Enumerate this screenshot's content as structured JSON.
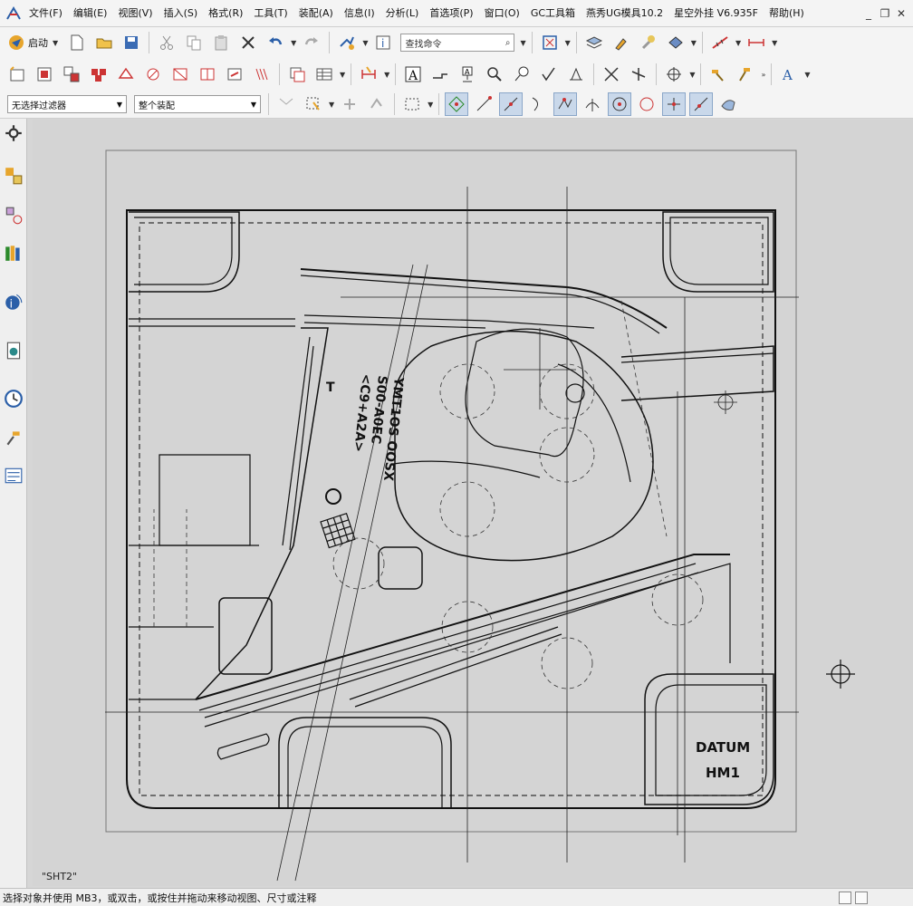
{
  "menu": {
    "items": [
      "文件(F)",
      "编辑(E)",
      "视图(V)",
      "插入(S)",
      "格式(R)",
      "工具(T)",
      "装配(A)",
      "信息(I)",
      "分析(L)",
      "首选项(P)",
      "窗口(O)",
      "GC工具箱",
      "燕秀UG模具10.2",
      "星空外挂 V6.935F",
      "帮助(H)"
    ]
  },
  "toolbar": {
    "start_label": "启动",
    "command_search_placeholder": "查找命令"
  },
  "selection": {
    "filter_value": "无选择过滤器",
    "scope_value": "整个装配"
  },
  "drawing": {
    "sheet_name": "\"SHT2\"",
    "engrave_line1": "YMT1OS OOSX",
    "engrave_line2": "S00-A0EC",
    "engrave_line3": "<C9+A2A>",
    "datum_label_line1": "DATUM",
    "datum_label_line2": "HM1",
    "small_mark": "T"
  },
  "status": {
    "message": "选择对象并使用 MB3，或双击，或按住并拖动来移动视图、尺寸或注释"
  },
  "colors": {
    "accent": "#2b5fa8",
    "canvas_bg": "#d4d4d4",
    "line": "#111111"
  }
}
